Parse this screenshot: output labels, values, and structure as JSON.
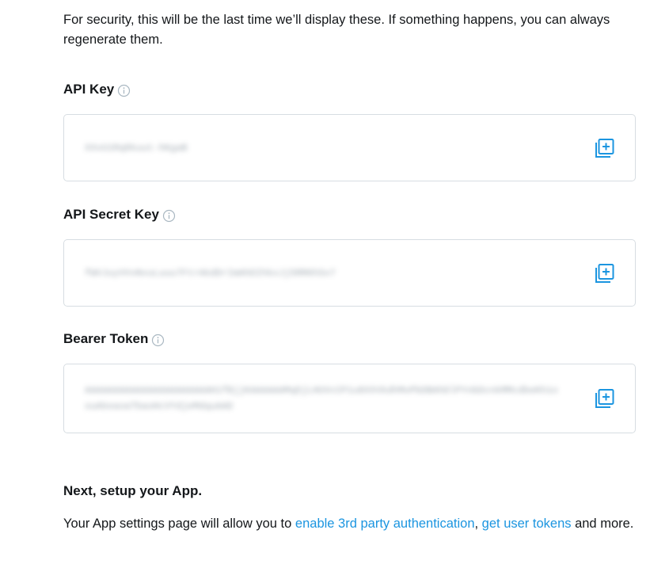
{
  "intro": {
    "text": "For security, this will be the last time we’ll display these. If something happens, you can always regenerate them."
  },
  "fields": [
    {
      "label": "API Key",
      "value": "XXvU1Rq8kuut-hKgaB",
      "copy_icon": "copy-icon"
    },
    {
      "label": "API Secret Key",
      "value": "fWVJuyVVvNvuLuuu7FtrAkdDrImAhDIhkxJj5RRKhSx7",
      "copy_icon": "copy-icon"
    },
    {
      "label": "Bearer Token",
      "value": "AAAAAAAAAAAAAAAAAAAAAAH1fBjjKAAAAAAMqDjLHUVcCP1u8XXVkdhMoPbDBAhDlPYnbDcnkMMcdbeKh1oouAkeaoaTbaoHcVYdjeMdquAAD",
      "copy_icon": "copy-icon"
    }
  ],
  "info_icon": "info-icon",
  "next": {
    "heading": "Next, setup your App.",
    "text_before": "Your App settings page will allow you to ",
    "link1": "enable 3rd party authentication",
    "separator": ", ",
    "link2": "get user tokens",
    "text_after": " and more."
  },
  "colors": {
    "accent": "#1b95e0",
    "text": "#14171a",
    "border": "#d7dde2",
    "muted": "#8f9aa3"
  }
}
